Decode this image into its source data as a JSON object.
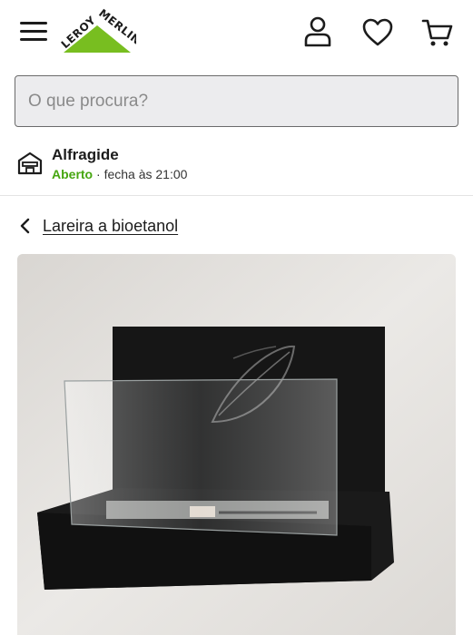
{
  "header": {
    "menu_icon": "hamburger-menu-icon",
    "logo_text_1": "LEROY",
    "logo_text_2": "MERLIN",
    "brand_green": "#78be20",
    "account_icon": "user-icon",
    "favorites_icon": "heart-icon",
    "cart_icon": "cart-icon"
  },
  "search": {
    "placeholder": "O que procura?",
    "value": ""
  },
  "store": {
    "icon": "store-icon",
    "name": "Alfragide",
    "status_open": "Aberto",
    "status_closes": "· fecha às 21:00",
    "status_color": "#46a610"
  },
  "breadcrumb": {
    "icon": "chevron-left-icon",
    "label": "Lareira a bioetanol"
  },
  "product": {
    "image": "product-image"
  }
}
